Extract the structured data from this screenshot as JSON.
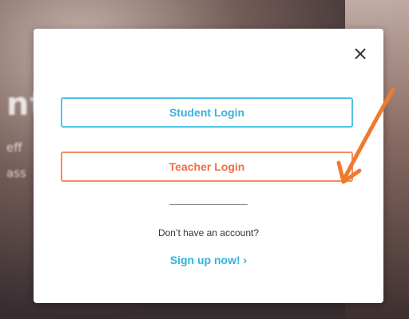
{
  "background": {
    "heading_fragment": "nt",
    "line1_fragment": "eff",
    "line2_fragment": "ass"
  },
  "modal": {
    "close_icon": "×",
    "student_login_label": "Student Login",
    "teacher_login_label": "Teacher Login",
    "no_account_text": "Don’t have an account?",
    "signup_label": "Sign up now! ›"
  },
  "colors": {
    "student_accent": "#4fc3e8",
    "teacher_accent": "#f28b67",
    "signup_link": "#2fb3dc",
    "annotation_arrow": "#f07a2c"
  },
  "icons": {
    "close": "close-icon",
    "annotation": "annotation-arrow-icon"
  }
}
